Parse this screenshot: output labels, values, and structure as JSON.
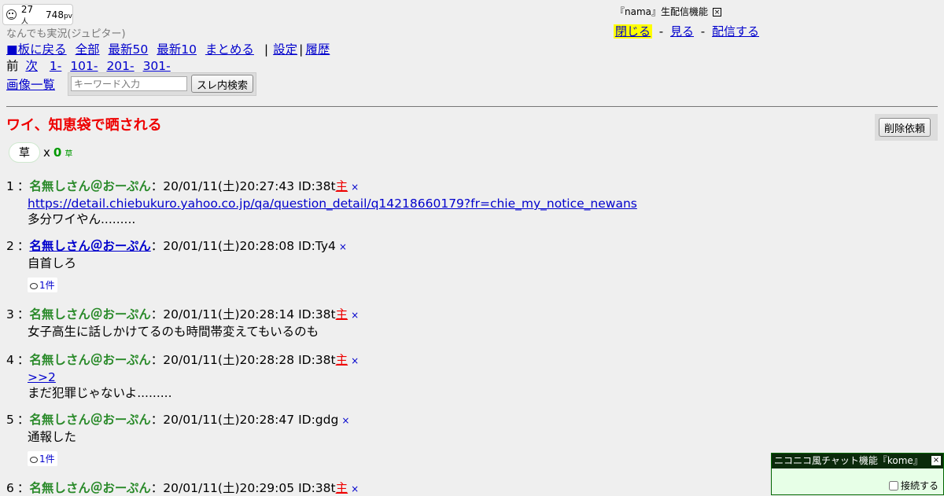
{
  "counter": {
    "viewers": "27",
    "viewers_unit": "人",
    "pv": "748",
    "pv_unit": "pv"
  },
  "board_name": "なんでも実況(ジュピター)",
  "nav": {
    "back": "■板に戻る",
    "all": "全部",
    "latest50": "最新50",
    "latest10": "最新10",
    "summarize": "まとめる",
    "sep": "|",
    "settings": "設定",
    "history": "履歴"
  },
  "pager": {
    "prev": "前",
    "next": "次",
    "p1": "1-",
    "p101": "101-",
    "p201": "201-",
    "p301": "301-"
  },
  "image_list": "画像一覧",
  "search": {
    "placeholder": "キーワード入力",
    "button": "スレ内検索"
  },
  "thread": {
    "title": "ワイ、知恵袋で晒される",
    "delete_request": "削除依頼"
  },
  "kusa": {
    "button": "草",
    "times": "x",
    "count": "0",
    "suffix": "草"
  },
  "nama": {
    "title": "『nama』生配信機能",
    "close_icon": "☒",
    "close": "閉じる",
    "watch": "見る",
    "broadcast": "配信する",
    "dash": "-"
  },
  "posts": [
    {
      "num": "1",
      "name": "名無しさん＠おーぷん",
      "date": "20/01/11(土)20:27:43",
      "id": "ID:38t",
      "owner": "主",
      "del": "×",
      "link": "https://detail.chiebukuro.yahoo.co.jp/qa/question_detail/q14218660179?fr=chie_my_notice_newans",
      "text": "多分ワイやん........."
    },
    {
      "num": "2",
      "name": "名無しさん＠おーぷん",
      "date": "20/01/11(土)20:28:08",
      "id": "ID:Ty4",
      "del": "×",
      "text": "自首しろ",
      "replies": "1件"
    },
    {
      "num": "3",
      "name": "名無しさん＠おーぷん",
      "date": "20/01/11(土)20:28:14",
      "id": "ID:38t",
      "owner": "主",
      "del": "×",
      "text": "女子高生に話しかけてるのも時間帯変えてもいるのも"
    },
    {
      "num": "4",
      "name": "名無しさん＠おーぷん",
      "date": "20/01/11(土)20:28:28",
      "id": "ID:38t",
      "owner": "主",
      "del": "×",
      "anchor": ">>2",
      "text": "まだ犯罪じゃないよ........."
    },
    {
      "num": "5",
      "name": "名無しさん＠おーぷん",
      "date": "20/01/11(土)20:28:47",
      "id": "ID:gdg",
      "del": "×",
      "text": "通報した",
      "replies": "1件"
    },
    {
      "num": "6",
      "name": "名無しさん＠おーぷん",
      "date": "20/01/11(土)20:29:05",
      "id": "ID:38t",
      "owner": "主",
      "del": "×"
    }
  ],
  "chat": {
    "title": "ニコニコ風チャット機能『kome』",
    "close_icon": "☒",
    "connect": "接続する"
  }
}
